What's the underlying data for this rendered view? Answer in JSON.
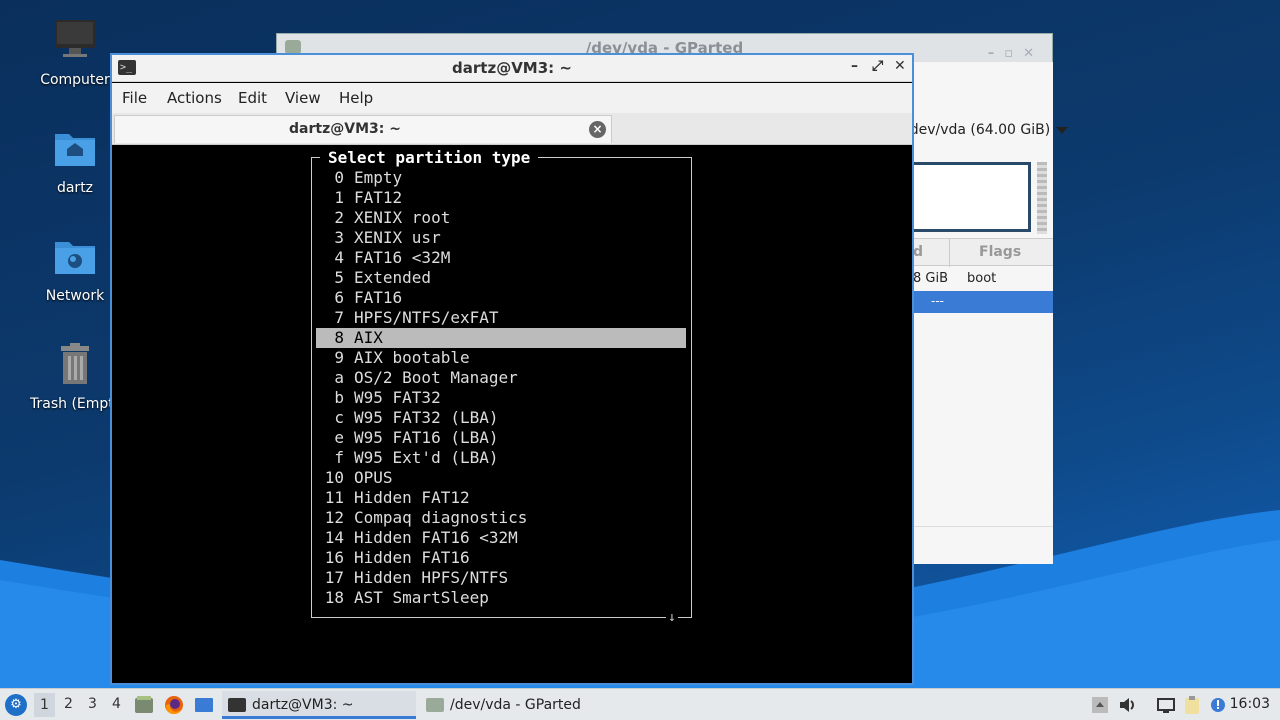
{
  "desktop": {
    "icons": [
      {
        "label": "Computer",
        "icon": "computer-icon"
      },
      {
        "label": "dartz",
        "icon": "home-folder-icon"
      },
      {
        "label": "Network",
        "icon": "network-folder-icon"
      },
      {
        "label": "Trash (Empty)",
        "icon": "trash-icon"
      }
    ]
  },
  "gparted": {
    "title": "/dev/vda - GParted",
    "device_selector": "/dev/vda (64.00 GiB)",
    "columns": [
      "d",
      "Flags"
    ],
    "row1": {
      "size": "8 GiB",
      "flags": "boot"
    },
    "row2": {
      "text": "---"
    }
  },
  "terminal": {
    "title": "dartz@VM3: ~",
    "menu": [
      "File",
      "Actions",
      "Edit",
      "View",
      "Help"
    ],
    "tab_label": "dartz@VM3: ~",
    "dialog": {
      "title": "Select partition type",
      "selected_index": 8,
      "options": [
        {
          "code": "0",
          "name": "Empty"
        },
        {
          "code": "1",
          "name": "FAT12"
        },
        {
          "code": "2",
          "name": "XENIX root"
        },
        {
          "code": "3",
          "name": "XENIX usr"
        },
        {
          "code": "4",
          "name": "FAT16 <32M"
        },
        {
          "code": "5",
          "name": "Extended"
        },
        {
          "code": "6",
          "name": "FAT16"
        },
        {
          "code": "7",
          "name": "HPFS/NTFS/exFAT"
        },
        {
          "code": "8",
          "name": "AIX"
        },
        {
          "code": "9",
          "name": "AIX bootable"
        },
        {
          "code": "a",
          "name": "OS/2 Boot Manager"
        },
        {
          "code": "b",
          "name": "W95 FAT32"
        },
        {
          "code": "c",
          "name": "W95 FAT32 (LBA)"
        },
        {
          "code": "e",
          "name": "W95 FAT16 (LBA)"
        },
        {
          "code": "f",
          "name": "W95 Ext'd (LBA)"
        },
        {
          "code": "10",
          "name": "OPUS"
        },
        {
          "code": "11",
          "name": "Hidden FAT12"
        },
        {
          "code": "12",
          "name": "Compaq diagnostics"
        },
        {
          "code": "14",
          "name": "Hidden FAT16 <32M"
        },
        {
          "code": "16",
          "name": "Hidden FAT16"
        },
        {
          "code": "17",
          "name": "Hidden HPFS/NTFS"
        },
        {
          "code": "18",
          "name": "AST SmartSleep"
        }
      ],
      "scroll_indicator": "↓"
    }
  },
  "taskbar": {
    "workspaces": [
      "1",
      "2",
      "3",
      "4"
    ],
    "active_workspace": "1",
    "tasks": [
      {
        "label": "dartz@VM3: ~",
        "icon": "terminal-icon"
      },
      {
        "label": "/dev/vda - GParted",
        "icon": "gparted-icon"
      }
    ],
    "clock": "16:03"
  }
}
